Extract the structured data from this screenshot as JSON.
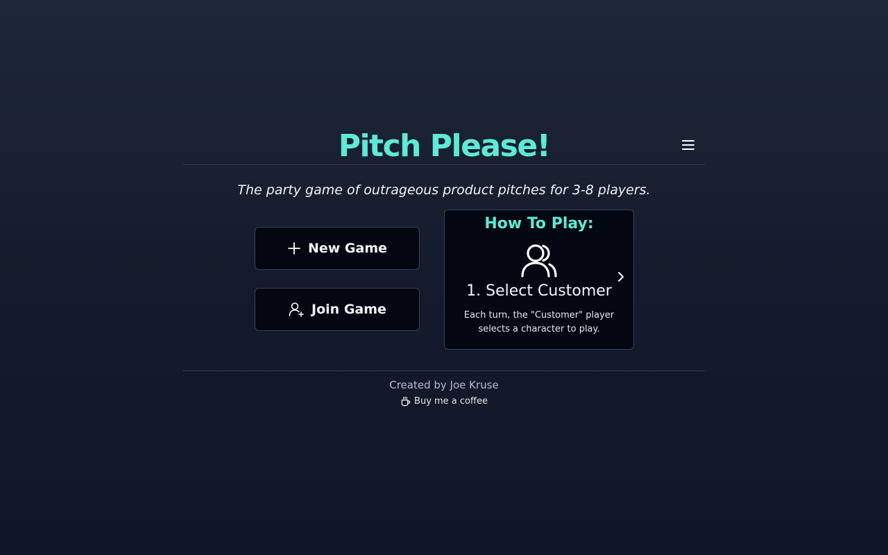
{
  "header": {
    "title": "Pitch Please!",
    "menu_icon": "hamburger-menu-icon"
  },
  "subtitle": "The party game of outrageous product pitches for 3-8 players.",
  "actions": {
    "new_game": {
      "label": "New Game",
      "icon": "plus-icon"
    },
    "join_game": {
      "label": "Join Game",
      "icon": "user-plus-icon"
    }
  },
  "how_to_play": {
    "title": "How To Play:",
    "icon": "users-icon",
    "step_title": "1. Select Customer",
    "step_description": "Each turn, the \"Customer\" player selects a character to play.",
    "next_icon": "chevron-right-icon"
  },
  "footer": {
    "credit": "Created by Joe Kruse",
    "coffee_label": "Buy me a coffee",
    "coffee_icon": "coffee-cup-icon"
  },
  "colors": {
    "accent": "#5eead4",
    "background_top": "#1e2739",
    "background_bottom": "#0f1628",
    "card": "#030712"
  }
}
